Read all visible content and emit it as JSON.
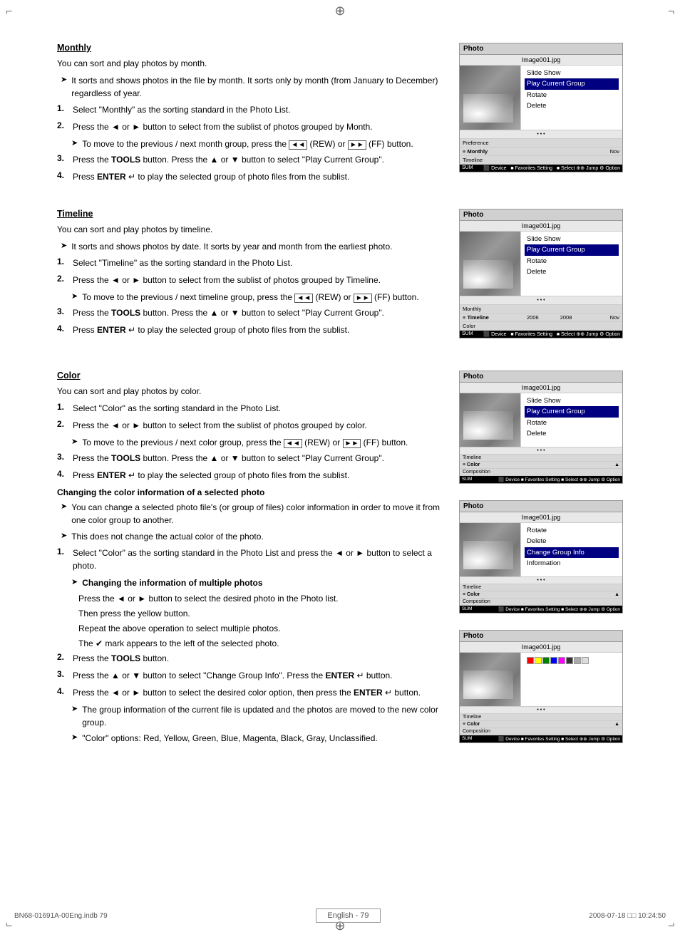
{
  "page": {
    "footer_left": "BN68-01691A-00Eng.indb   79",
    "footer_center": "English - 79",
    "footer_right": "2008-07-18   □□ 10:24:50",
    "footer_lang": "English"
  },
  "sections": [
    {
      "id": "monthly",
      "title": "Monthly",
      "desc": "You can sort and play photos by month.",
      "bullets": [
        "It sorts and shows photos in the file by month. It sorts only by month (from January to December) regardless of year."
      ],
      "numbered": [
        {
          "n": "1.",
          "text": "Select \"Monthly\" as the sorting standard in the Photo List."
        },
        {
          "n": "2.",
          "text": "Press the ◄ or ► button to select from the sublist of photos grouped by Month."
        },
        {
          "n": "",
          "sub": "To move to the previous / next month group, press the  (REW) or  (FF) button."
        },
        {
          "n": "3.",
          "text": "Press the TOOLS button. Press the ▲ or ▼ button to select \"Play Current Group\"."
        },
        {
          "n": "4.",
          "text": "Press ENTER  to play the selected group of photo files from the sublist."
        }
      ]
    },
    {
      "id": "timeline",
      "title": "Timeline",
      "desc": "You can sort and play photos by timeline.",
      "bullets": [
        "It sorts and shows photos by date. It sorts by year and month from the earliest photo."
      ],
      "numbered": [
        {
          "n": "1.",
          "text": "Select \"Timeline\" as the sorting standard in the Photo List."
        },
        {
          "n": "2.",
          "text": "Press the ◄ or ► button to select from the sublist of photos grouped by Timeline."
        },
        {
          "n": "",
          "sub": "To move to the previous / next timeline group, press the  (REW) or  (FF) button."
        },
        {
          "n": "3.",
          "text": "Press the TOOLS button. Press the ▲ or ▼ button to select \"Play Current Group\"."
        },
        {
          "n": "4.",
          "text": "Press ENTER  to play the selected group of photo files from the sublist."
        }
      ]
    },
    {
      "id": "color",
      "title": "Color",
      "desc": "You can sort and play photos by color.",
      "numbered": [
        {
          "n": "1.",
          "text": "Select \"Color\" as the sorting standard in the Photo List."
        },
        {
          "n": "2.",
          "text": "Press the ◄ or ► button to select from the sublist of photos grouped by color."
        },
        {
          "n": "",
          "sub": "To move to the previous / next color group, press the  (REW) or  (FF) button."
        },
        {
          "n": "3.",
          "text": "Press the TOOLS button. Press the ▲ or ▼ button to select \"Play Current Group\"."
        },
        {
          "n": "4.",
          "text": "Press ENTER  to play the selected group of photo files from the sublist."
        }
      ]
    }
  ],
  "changing_color": {
    "title": "Changing the color information of a selected photo",
    "bullets": [
      "You can change a selected photo file's (or group of files) color information in order to move it from one color group to another.",
      "This does not change the actual color of the photo."
    ],
    "numbered": [
      {
        "n": "1.",
        "text": "Select \"Color\" as the sorting standard in the Photo List and press the ◄ or ► button to select a photo."
      },
      {
        "n": "",
        "sub_title": "➤ Changing the information of multiple photos",
        "sub_items": [
          "Press the ◄ or ► button to select the desired photo in the Photo list.",
          "Then press the yellow button.",
          "Repeat the above operation to select multiple photos.",
          "The ✔ mark appears to the left of the selected photo."
        ]
      },
      {
        "n": "2.",
        "text": "Press the TOOLS button."
      },
      {
        "n": "3.",
        "text": "Press the ▲ or ▼ button to select \"Change Group Info\". Press the ENTER  button."
      },
      {
        "n": "4.",
        "text": "Press the ◄ or ► button to select the desired color option, then press the ENTER  button."
      },
      {
        "n": "",
        "sub": "The group information of the current file is updated and the photos are moved to the new color group."
      },
      {
        "n": "",
        "sub": "\"Color\" options: Red, Yellow, Green, Blue, Magenta, Black, Gray, Unclassified."
      }
    ]
  },
  "panels": {
    "monthly": {
      "header": "Photo",
      "filename": "Image001.jpg",
      "menu_items": [
        "Slide Show",
        "Play Current Group",
        "Rotate",
        "Delete"
      ],
      "selected": 1,
      "footer_left": "Monthly",
      "footer_timeline": "Timeline",
      "footer_bar": "SUM",
      "pref": "Preference",
      "months": [
        "",
        "Nov"
      ]
    },
    "timeline": {
      "header": "Photo",
      "filename": "Image001.jpg",
      "menu_items": [
        "Slide Show",
        "Play Current Group",
        "Rotate",
        "Delete"
      ],
      "selected": 1,
      "footer_left": "Monthly",
      "footer_timeline": "Timeline",
      "footer_bar": "SUM",
      "years": [
        "2006",
        "2008"
      ],
      "month_end": "Nov"
    },
    "color1": {
      "header": "Photo",
      "filename": "Image001.jpg",
      "menu_items": [
        "Slide Show",
        "Play Current Group",
        "Rotate",
        "Delete"
      ],
      "selected": 1,
      "footer_left": "Timeline",
      "footer_mid": "Color",
      "footer_bar": "SUM"
    },
    "color2": {
      "header": "Photo",
      "filename": "Image001.jpg",
      "menu_items": [
        "Rotate",
        "Delete",
        "Change Group Info",
        "Information"
      ],
      "selected": 0,
      "footer_left": "Timeline",
      "footer_mid": "Color",
      "footer_bar": "SUM"
    },
    "color3": {
      "header": "Photo",
      "filename": "Image001.jpg",
      "menu_items": [],
      "footer_left": "Timeline",
      "footer_mid2": "Color",
      "footer_bot": "Composition",
      "footer_bar": "SUM"
    }
  }
}
